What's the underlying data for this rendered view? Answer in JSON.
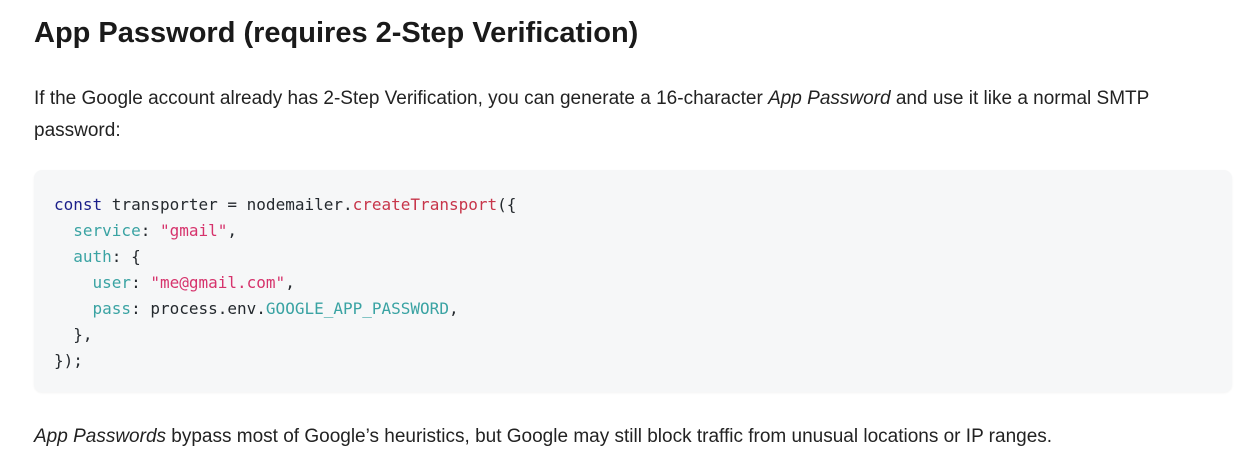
{
  "heading": "App Password (requires 2-Step Verification)",
  "intro": {
    "before": "If the Google account already has 2-Step Verification, you can generate a 16-character ",
    "emphasis": "App Password",
    "after": " and use it like a normal SMTP password:"
  },
  "code": {
    "line1": {
      "kw": "const",
      "plain1": " transporter = nodemailer.",
      "fn": "createTransport",
      "plain2": "({"
    },
    "line2": {
      "indent": "  ",
      "key": "service",
      "sep": ": ",
      "str": "\"gmail\"",
      "end": ","
    },
    "line3": {
      "indent": "  ",
      "key": "auth",
      "sep": ": {"
    },
    "line4": {
      "indent": "    ",
      "key": "user",
      "sep": ": ",
      "str": "\"me@gmail.com\"",
      "end": ","
    },
    "line5": {
      "indent": "    ",
      "key": "pass",
      "sep": ": process.env.",
      "const": "GOOGLE_APP_PASSWORD",
      "end": ","
    },
    "line6": "  },",
    "line7": "});"
  },
  "footer": {
    "emphasis": "App Passwords",
    "rest": " bypass most of Google’s heuristics, but Google may still block traffic from unusual locations or IP ranges."
  }
}
